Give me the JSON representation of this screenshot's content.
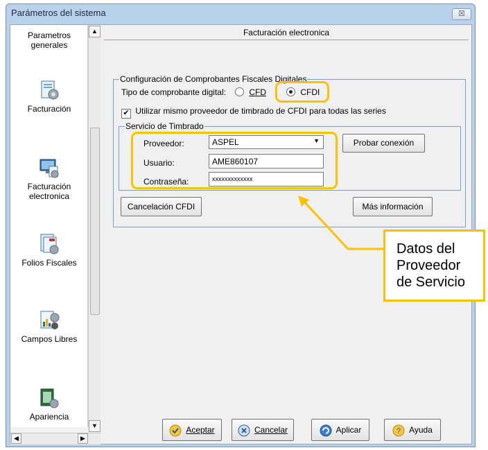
{
  "window": {
    "title": "Parámetros del sistema",
    "close_glyph": "☒"
  },
  "sidebar": {
    "items": [
      {
        "label": "Parametros generales",
        "icon": "settings-icon"
      },
      {
        "label": "Facturación",
        "icon": "invoice-icon"
      },
      {
        "label": "Facturación electronica",
        "icon": "electronic-invoice-icon"
      },
      {
        "label": "Folios Fiscales",
        "icon": "fiscal-folios-icon"
      },
      {
        "label": "Campos Libres",
        "icon": "free-fields-icon"
      },
      {
        "label": "Apariencia",
        "icon": "appearance-icon"
      }
    ]
  },
  "panel": {
    "title": "Facturación electronica",
    "group_label": "Configuración de Comprobantes Fiscales Digitales",
    "tipo_label": "Tipo de comprobante digital:",
    "radio_cfd": "CFD",
    "radio_cfdi": "CFDI",
    "radio_selected": "CFDI",
    "checkbox_label": "Utilizar mismo proveedor de timbrado de CFDI para  todas las series",
    "checkbox_checked": true,
    "timbrado_group": "Servicio de Timbrado",
    "proveedor_label": "Proveedor:",
    "proveedor_value": "ASPEL",
    "usuario_label": "Usuario:",
    "usuario_value": "AME860107",
    "contrasena_label": "Contraseña:",
    "contrasena_value": "xxxxxxxxxxxxx",
    "probar_button": "Probar conexión",
    "cancelacion_button": "Cancelación CFDI",
    "mas_info_button": "Más información"
  },
  "footer": {
    "aceptar": "Aceptar",
    "cancelar": "Cancelar",
    "aplicar": "Aplicar",
    "ayuda": "Ayuda"
  },
  "callout": {
    "line1": "Datos del",
    "line2": "Proveedor",
    "line3": "de Servicio"
  },
  "colors": {
    "highlight": "#ffc000",
    "group_border": "#7a9fc7",
    "window_frame": "#b9d1ea"
  }
}
